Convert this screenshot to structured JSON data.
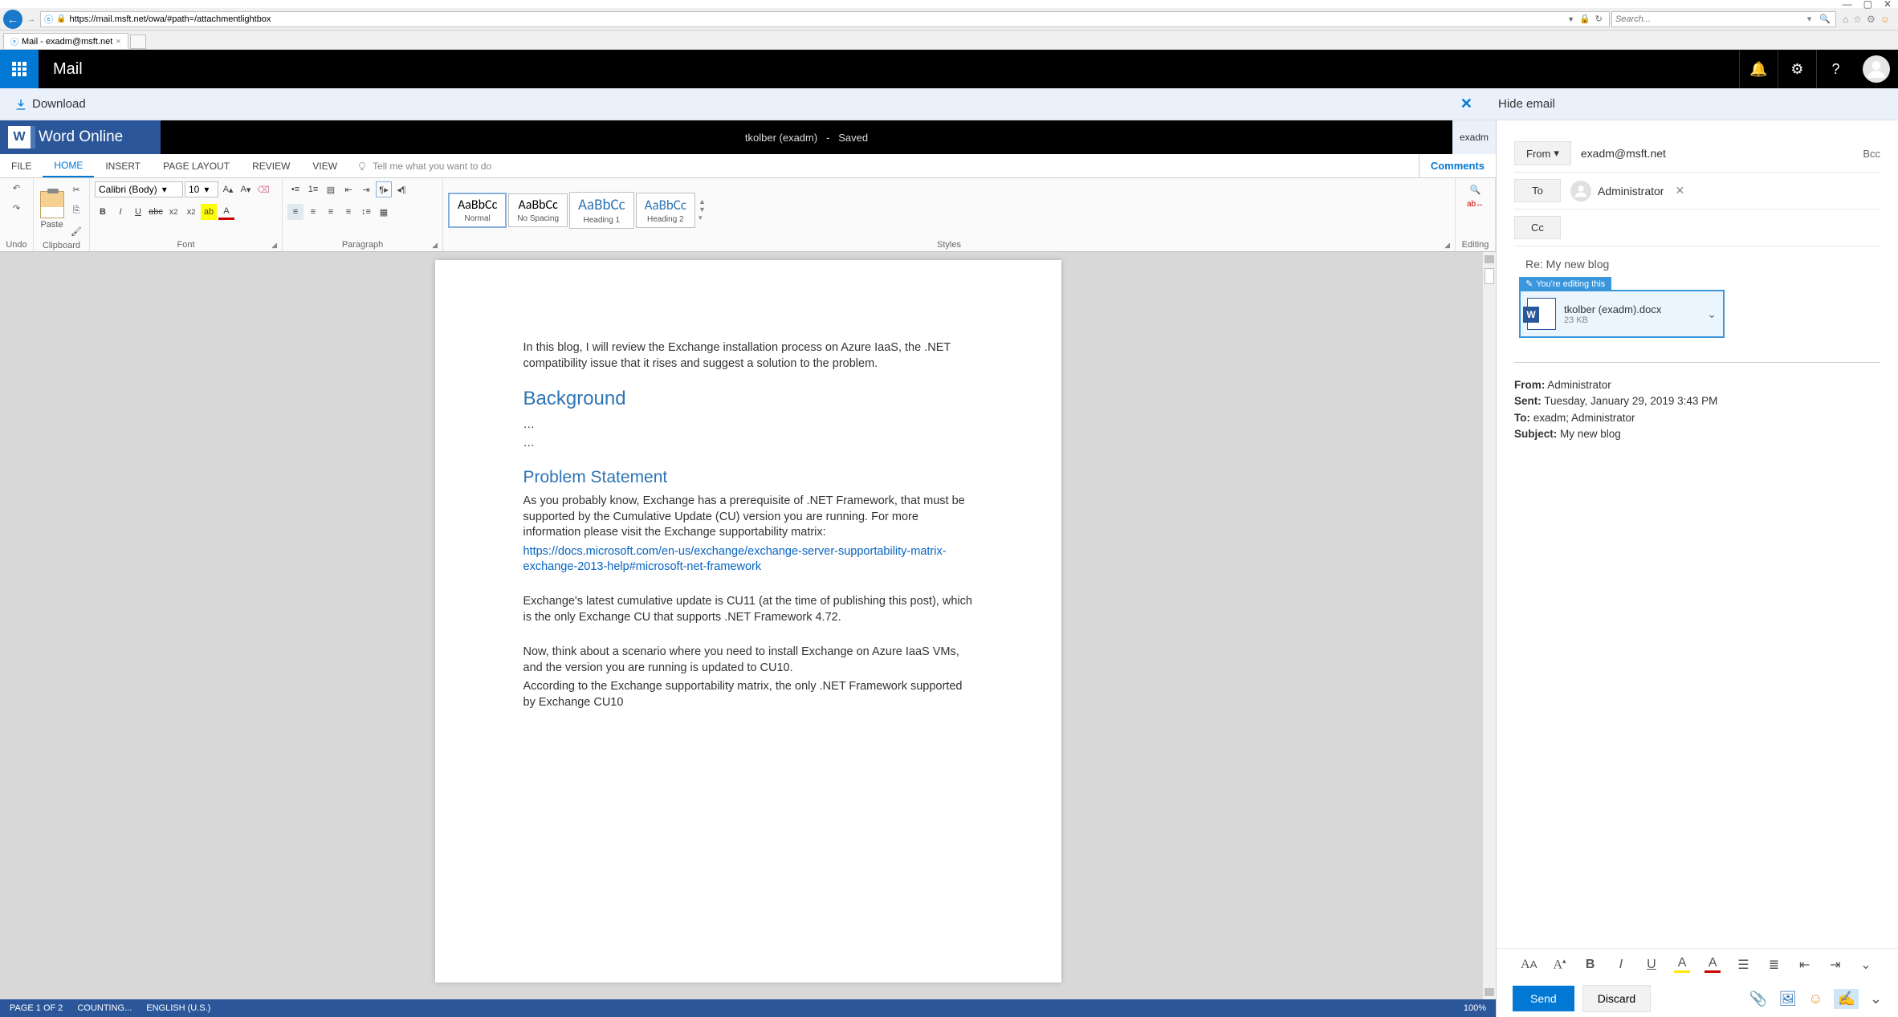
{
  "browser": {
    "url": "https://mail.msft.net/owa/#path=/attachmentlightbox",
    "search_placeholder": "Search...",
    "tab_title": "Mail - exadm@msft.net"
  },
  "header": {
    "app_title": "Mail"
  },
  "lightbox": {
    "download": "Download",
    "hide_email": "Hide email"
  },
  "word": {
    "brand": "Word Online",
    "doc_name": "tkolber (exadm)",
    "doc_sep": "-",
    "doc_status": "Saved",
    "user": "exadm",
    "tabs": {
      "file": "FILE",
      "home": "HOME",
      "insert": "INSERT",
      "page_layout": "PAGE LAYOUT",
      "review": "REVIEW",
      "view": "VIEW",
      "tellme": "Tell me what you want to do",
      "comments": "Comments"
    },
    "ribbon": {
      "undo_group": "Undo",
      "clipboard_group": "Clipboard",
      "paste": "Paste",
      "font_group": "Font",
      "font_name": "Calibri (Body)",
      "font_size": "10",
      "paragraph_group": "Paragraph",
      "styles_group": "Styles",
      "editing_group": "Editing",
      "styles": [
        {
          "preview": "AaBbCc",
          "label": "Normal"
        },
        {
          "preview": "AaBbCc",
          "label": "No Spacing"
        },
        {
          "preview": "AaBbCc",
          "label": "Heading 1"
        },
        {
          "preview": "AaBbCc",
          "label": "Heading 2"
        }
      ]
    },
    "document": {
      "intro": "In this blog, I will review the Exchange installation process on Azure IaaS, the .NET compatibility issue that it rises and suggest a solution to the problem.",
      "h_background": "Background",
      "dots1": "…",
      "dots2": "…",
      "h_problem": "Problem Statement",
      "p1": "As you probably know, Exchange has a prerequisite of .NET Framework, that must be supported by the Cumulative Update (CU) version you are running. For more information please visit the Exchange supportability matrix:",
      "link": "https://docs.microsoft.com/en-us/exchange/exchange-server-supportability-matrix-exchange-2013-help#microsoft-net-framework",
      "p2": "Exchange's latest cumulative update is CU11 (at the time of publishing this post), which is the only Exchange CU that supports .NET Framework 4.72.",
      "p3": "Now, think about a scenario where you need to install Exchange on Azure IaaS VMs, and the version you are running is updated to CU10.",
      "p4": "According to the Exchange supportability matrix, the only .NET Framework supported by Exchange CU10"
    },
    "status": {
      "page": "PAGE 1 OF 2",
      "count": "COUNTING...",
      "lang": "ENGLISH (U.S.)",
      "zoom": "100%"
    }
  },
  "compose": {
    "from_label": "From",
    "from_value": "exadm@msft.net",
    "bcc": "Bcc",
    "to_label": "To",
    "to_name": "Administrator",
    "cc_label": "Cc",
    "subject": "Re: My new blog",
    "attachment": {
      "badge": "You're editing this",
      "filename": "tkolber (exadm).docx",
      "size": "23 KB"
    },
    "quoted": {
      "from_lbl": "From:",
      "from_val": " Administrator",
      "sent_lbl": "Sent:",
      "sent_val": " Tuesday, January 29, 2019 3:43 PM",
      "to_lbl": "To:",
      "to_val": " exadm; Administrator",
      "subj_lbl": "Subject:",
      "subj_val": " My new blog"
    },
    "send": "Send",
    "discard": "Discard"
  }
}
